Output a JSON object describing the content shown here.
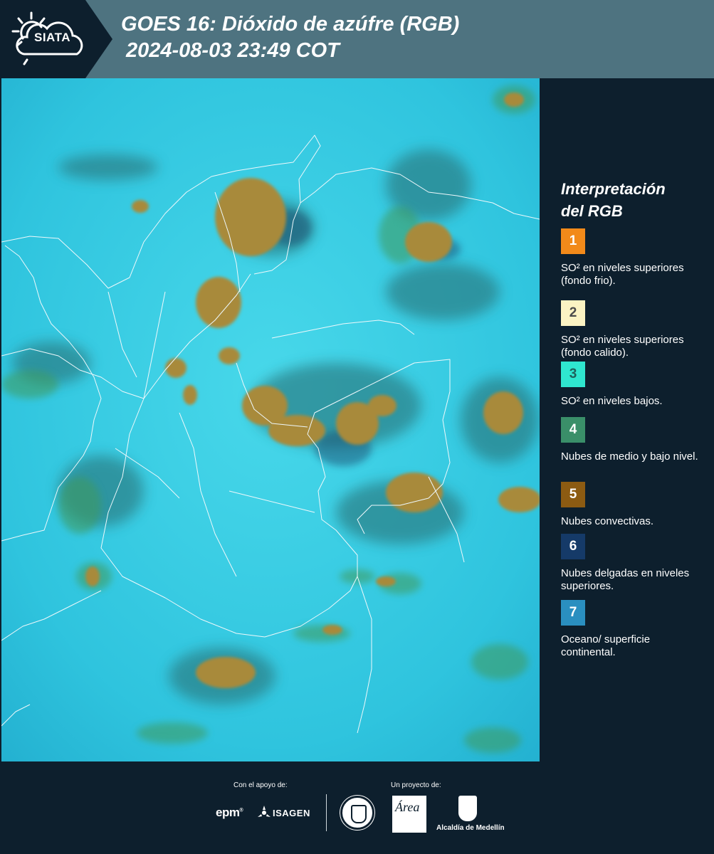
{
  "header": {
    "logo_text": "SIATA",
    "title_line1": "GOES 16: Dióxido de azúfre (RGB)",
    "title_line2": "2024-08-03 23:49 COT"
  },
  "legend": {
    "title_line1": "Interpretación",
    "title_line2": "del RGB",
    "items": [
      {
        "number": "1",
        "color": "#f28a1a",
        "text": "SO² en niveles superiores (fondo frio)."
      },
      {
        "number": "2",
        "color": "#fbf3c3",
        "text": "SO² en niveles superiores (fondo calido)."
      },
      {
        "number": "3",
        "color": "#2fe6cf",
        "text": "SO² en niveles bajos."
      },
      {
        "number": "4",
        "color": "#3a8f69",
        "text": "Nubes de medio y bajo nivel."
      },
      {
        "number": "5",
        "color": "#8c5b12",
        "text": "Nubes convectivas."
      },
      {
        "number": "6",
        "color": "#153a68",
        "text": "Nubes delgadas en niveles superiores."
      },
      {
        "number": "7",
        "color": "#2a8fc0",
        "text": "Oceano/ superficie continental."
      }
    ]
  },
  "footer": {
    "support_label": "Con el apoyo de:",
    "project_label": "Un proyecto de:",
    "sponsor_epm": "epm",
    "sponsor_isagen": "ISAGEN",
    "partner_area": "Área",
    "partner_alcaldia": "Alcaldía de Medellín"
  }
}
